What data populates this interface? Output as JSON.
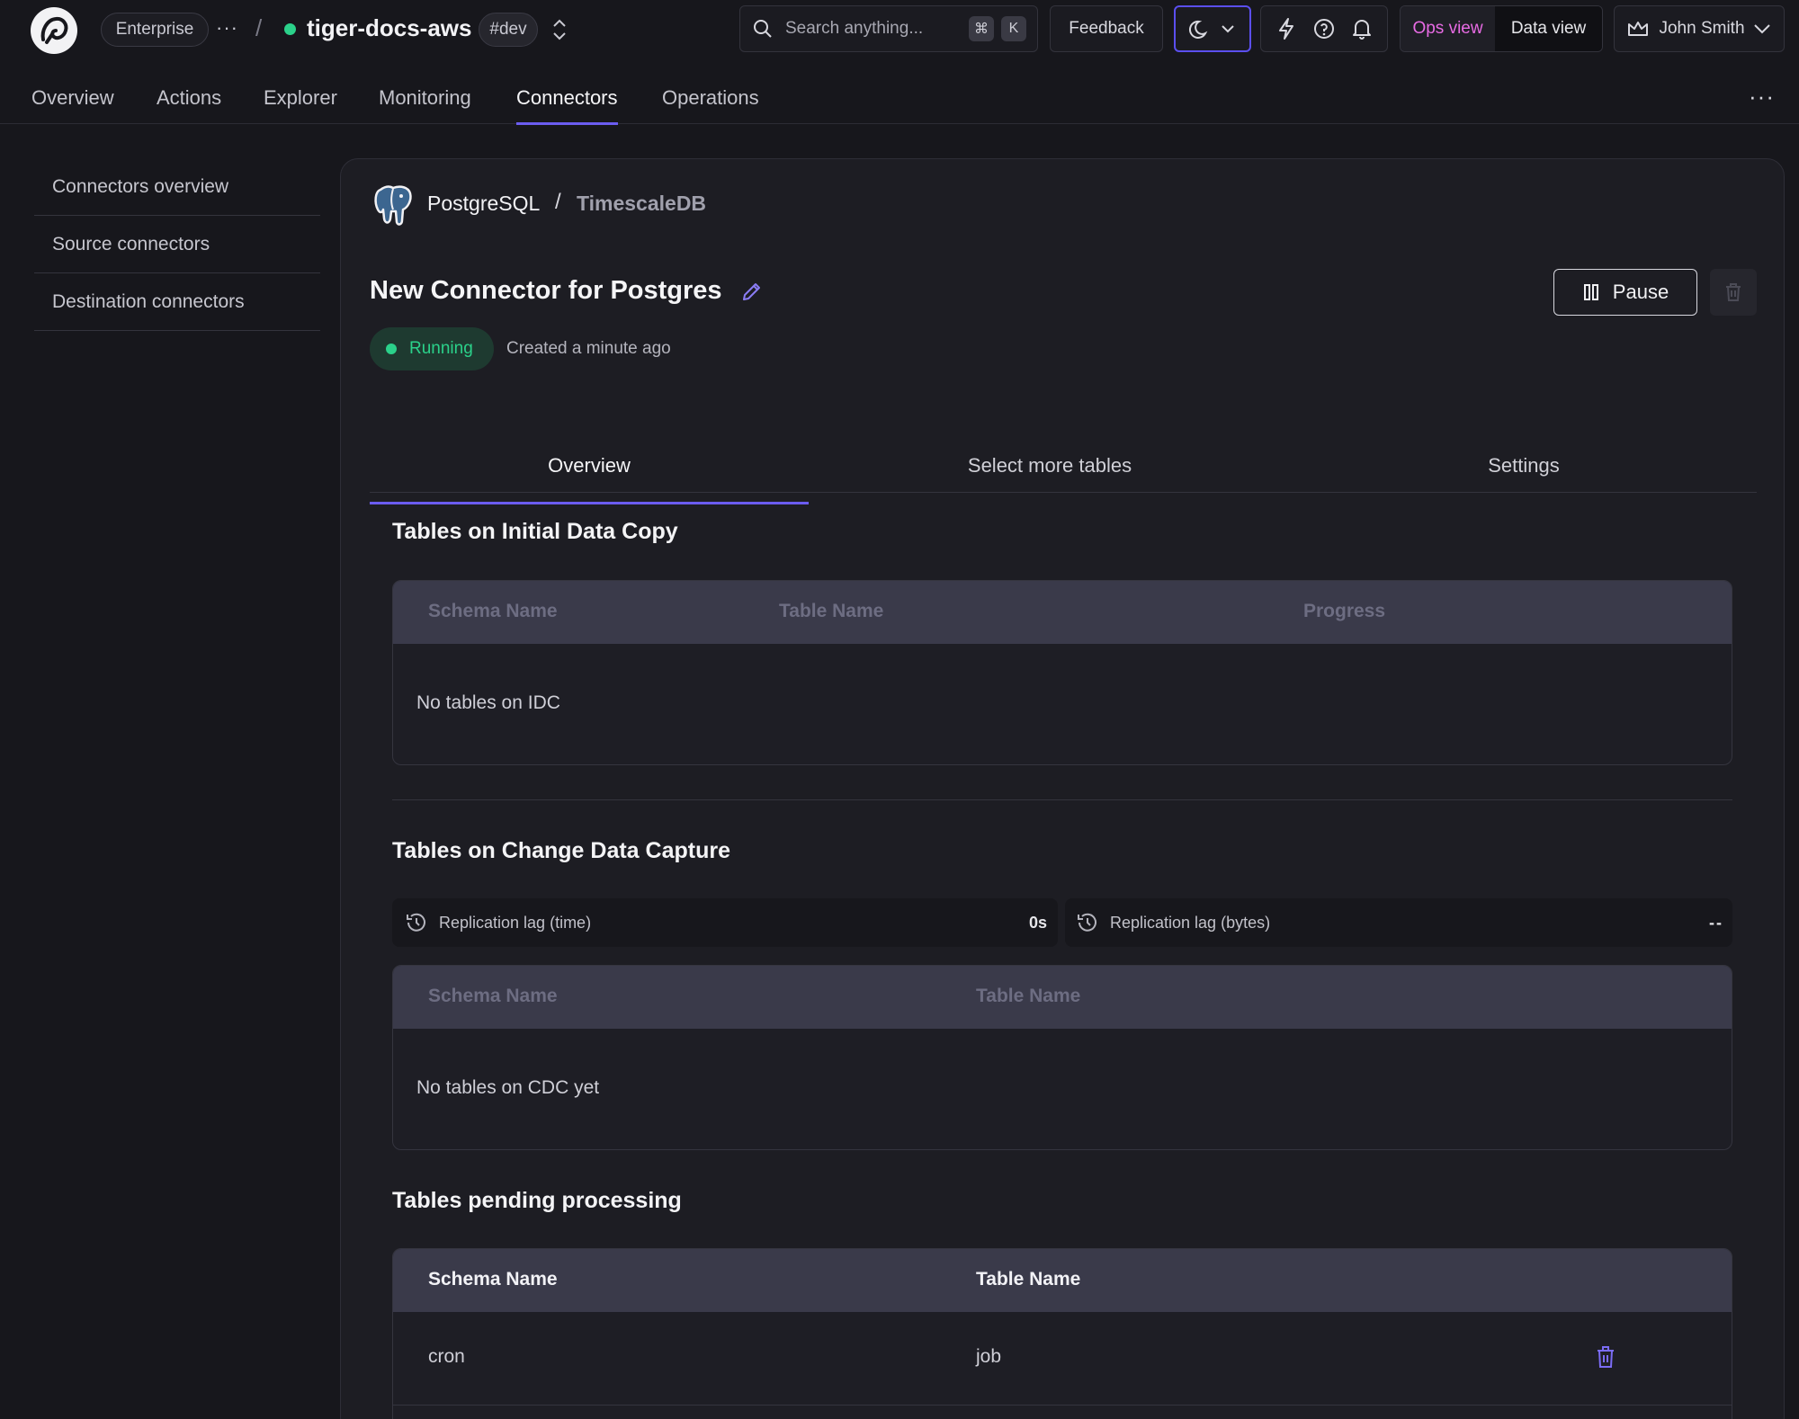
{
  "topbar": {
    "plan": "Enterprise",
    "more": "···",
    "separator": "/",
    "service_name": "tiger-docs-aws",
    "env_tag": "#dev",
    "search_placeholder": "Search anything...",
    "search_shortcut_1": "⌘",
    "search_shortcut_2": "K",
    "feedback": "Feedback",
    "ops_view": "Ops view",
    "data_view": "Data view",
    "user_name": "John Smith",
    "accent_color": "#e86be4",
    "status_color": "#2bd18a"
  },
  "nav": {
    "items": [
      "Overview",
      "Actions",
      "Explorer",
      "Monitoring",
      "Connectors",
      "Operations"
    ],
    "active": "Connectors",
    "more": "···"
  },
  "sidebar": {
    "items": [
      "Connectors overview",
      "Source connectors",
      "Destination connectors"
    ]
  },
  "connector": {
    "source": "PostgreSQL",
    "separator": "/",
    "destination": "TimescaleDB",
    "title": "New Connector for Postgres",
    "status": "Running",
    "created": "Created a minute ago",
    "pause_label": "Pause"
  },
  "tabs": [
    "Overview",
    "Select more tables",
    "Settings"
  ],
  "idc": {
    "title": "Tables on Initial Data Copy",
    "headers": [
      "Schema Name",
      "Table Name",
      "Progress"
    ],
    "empty": "No tables on IDC"
  },
  "cdc": {
    "title": "Tables on Change Data Capture",
    "lag_time_label": "Replication lag (time)",
    "lag_time_value": "0s",
    "lag_bytes_label": "Replication lag (bytes)",
    "lag_bytes_value": "--",
    "headers": [
      "Schema Name",
      "Table Name"
    ],
    "empty": "No tables on CDC yet"
  },
  "pending": {
    "title": "Tables pending processing",
    "headers": [
      "Schema Name",
      "Table Name"
    ],
    "rows": [
      {
        "schema": "cron",
        "table": "job"
      }
    ]
  }
}
